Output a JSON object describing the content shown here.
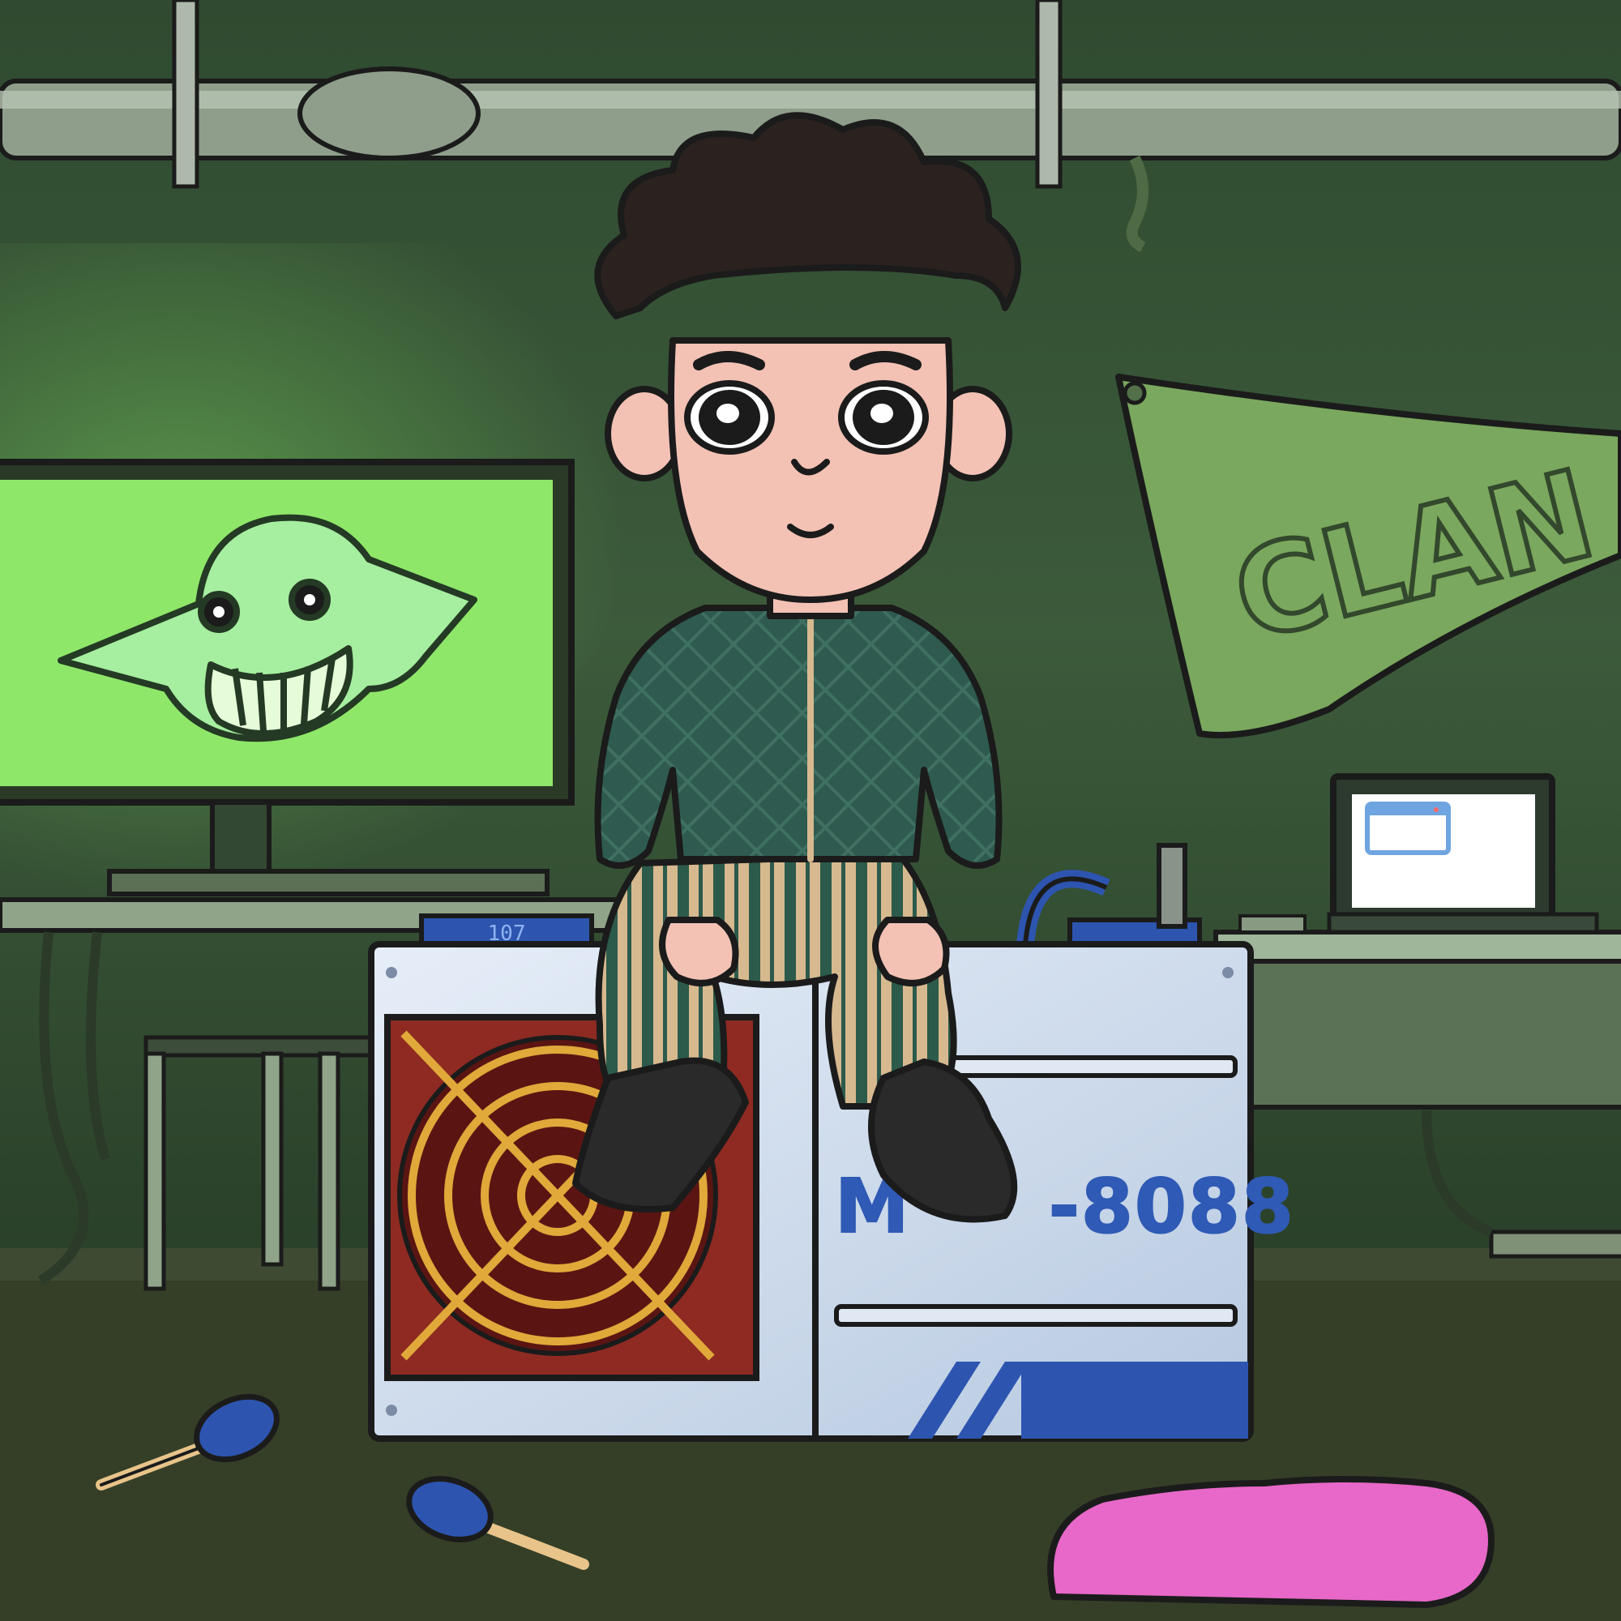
{
  "scene": {
    "miner_label": "M     -8088",
    "miner_top_readout": "107",
    "banner_text": "CLAN"
  },
  "colors": {
    "wall": "#3b5a3a",
    "wall_dark": "#243a25",
    "floor": "#353f27",
    "monitor_screen": "#8fe76a",
    "miner_body": "#c9d8ea",
    "miner_label": "#2f5ab5",
    "fan_red": "#8e2a22",
    "fan_gold": "#e0a93a",
    "jacket": "#2f5a4f",
    "pants_stripe_light": "#d7b98f",
    "pants_stripe_dark": "#2c5a4b",
    "skin": "#f3c2b5",
    "hair": "#2b2220",
    "rug_pink": "#e768c8"
  },
  "icons": [
    "goblin-icon",
    "window-icon",
    "maraca-icon",
    "fan-grill-icon"
  ]
}
